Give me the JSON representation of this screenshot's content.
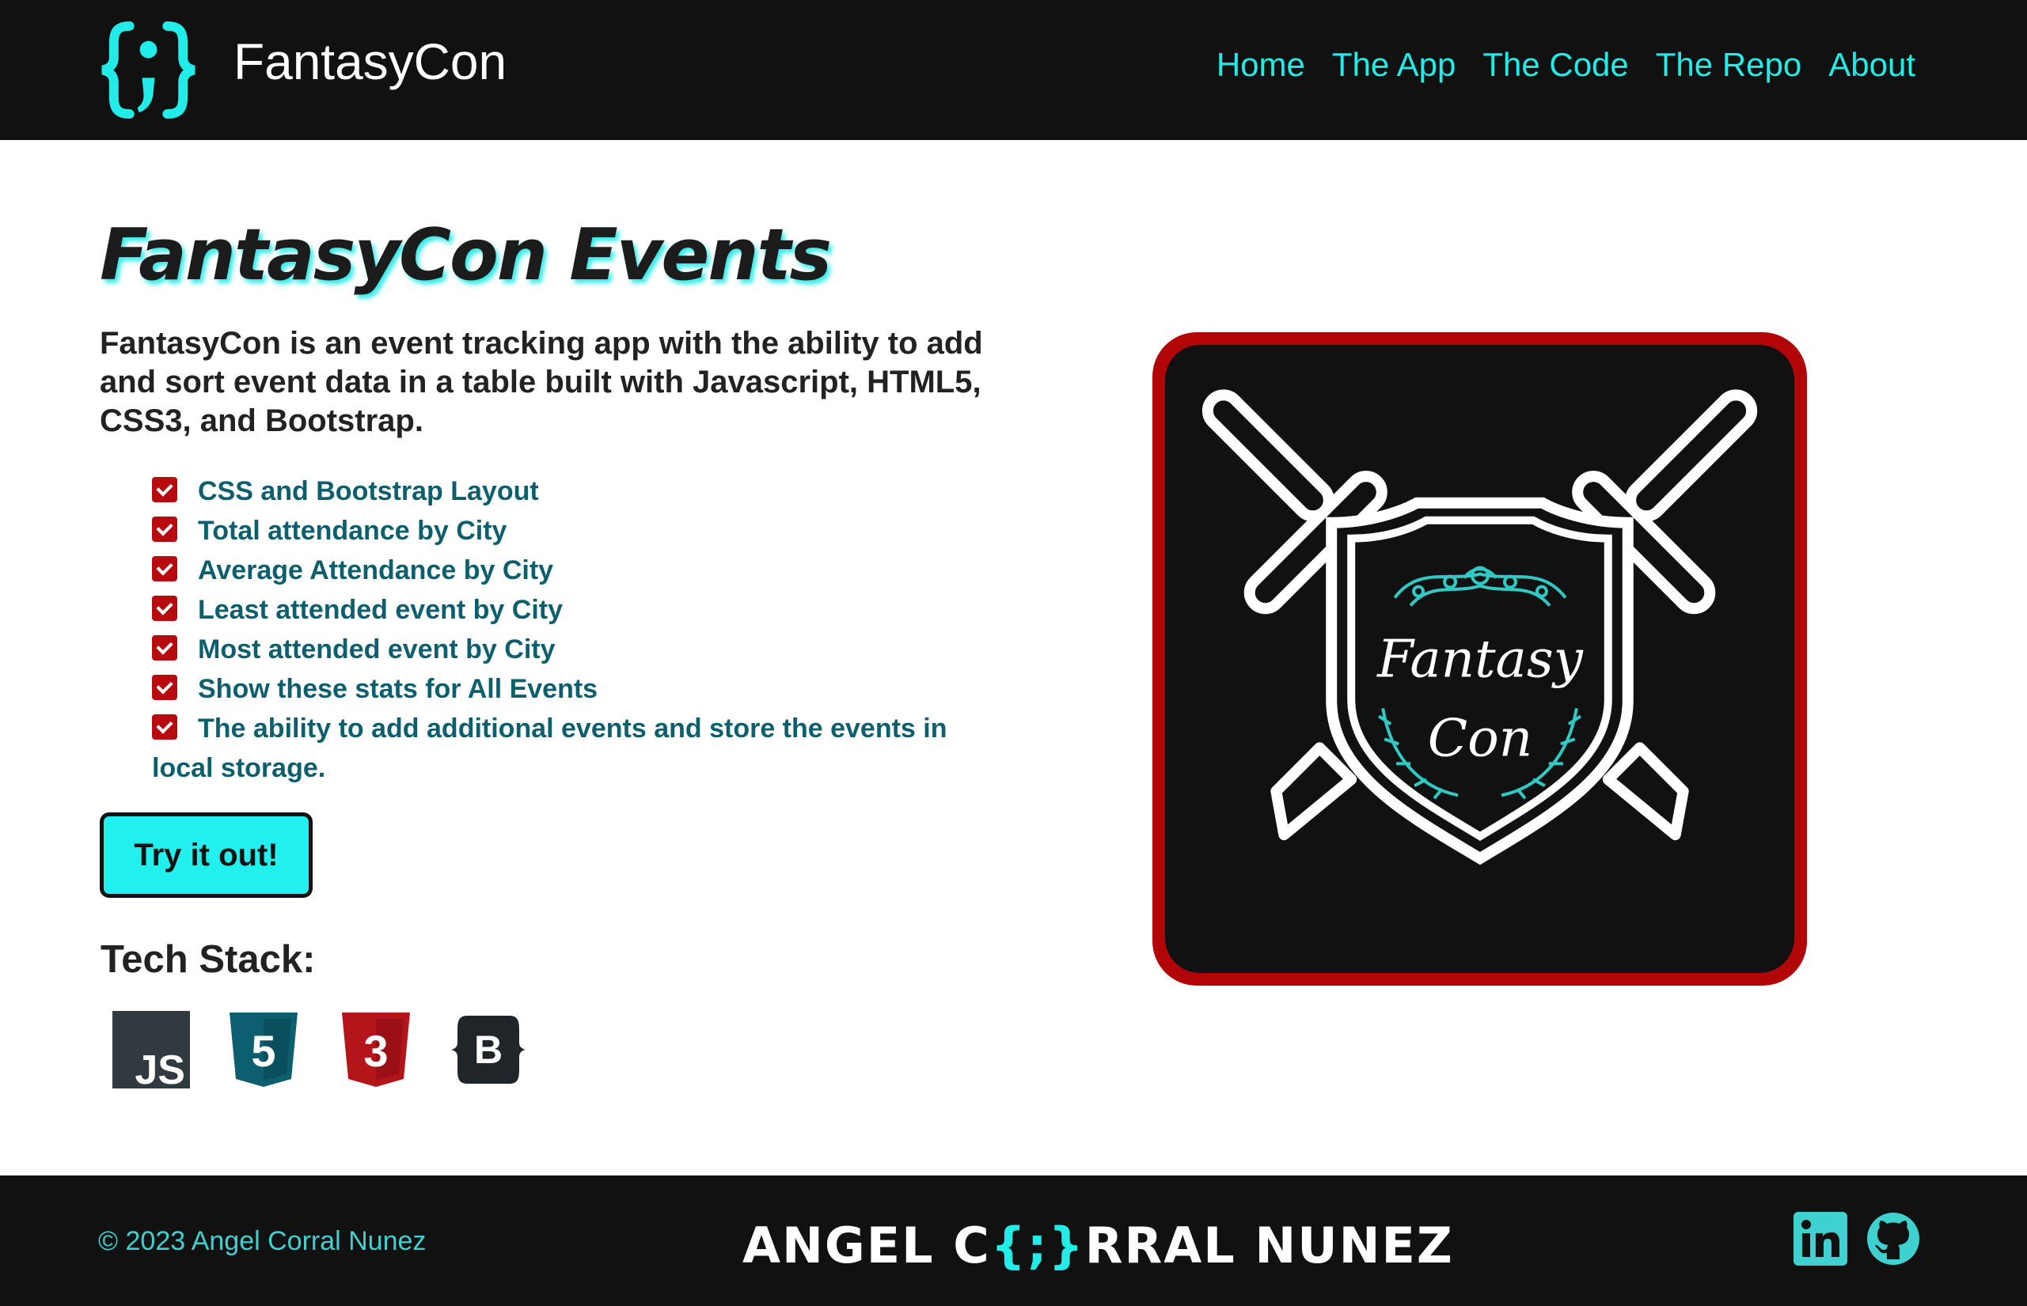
{
  "header": {
    "brand_name": "FantasyCon",
    "nav": [
      "Home",
      "The App",
      "The Code",
      "The Repo",
      "About"
    ]
  },
  "main": {
    "title": "FantasyCon Events",
    "description": "FantasyCon is an event tracking app with the ability to add and sort event data in a table built with Javascript, HTML5, CSS3, and Bootstrap.",
    "features": [
      "CSS and Bootstrap Layout",
      "Total attendance by City",
      "Average Attendance by City",
      "Least attended event by City",
      "Most attended event by City",
      "Show these stats for All Events",
      "The ability to add additional events and store the events in local storage."
    ],
    "cta_label": "Try it out!",
    "tech_stack_title": "Tech Stack:",
    "tech_stack": [
      {
        "icon": "javascript-icon",
        "label": "JS"
      },
      {
        "icon": "html5-icon",
        "label": "5"
      },
      {
        "icon": "css3-icon",
        "label": "3"
      },
      {
        "icon": "bootstrap-icon",
        "label": "B"
      }
    ]
  },
  "showcase": {
    "logo_line1": "Fantasy",
    "logo_line2": "Con"
  },
  "footer": {
    "copyright": "© 2023 Angel Corral Nunez",
    "signature_part1": "ANGEL C",
    "signature_mark": "{;}",
    "signature_part2": "RRAL NUNEZ"
  },
  "colors": {
    "accent": "#21ece7",
    "dark": "#111111",
    "red": "#b10508",
    "feature_text": "#0e5f6e"
  }
}
